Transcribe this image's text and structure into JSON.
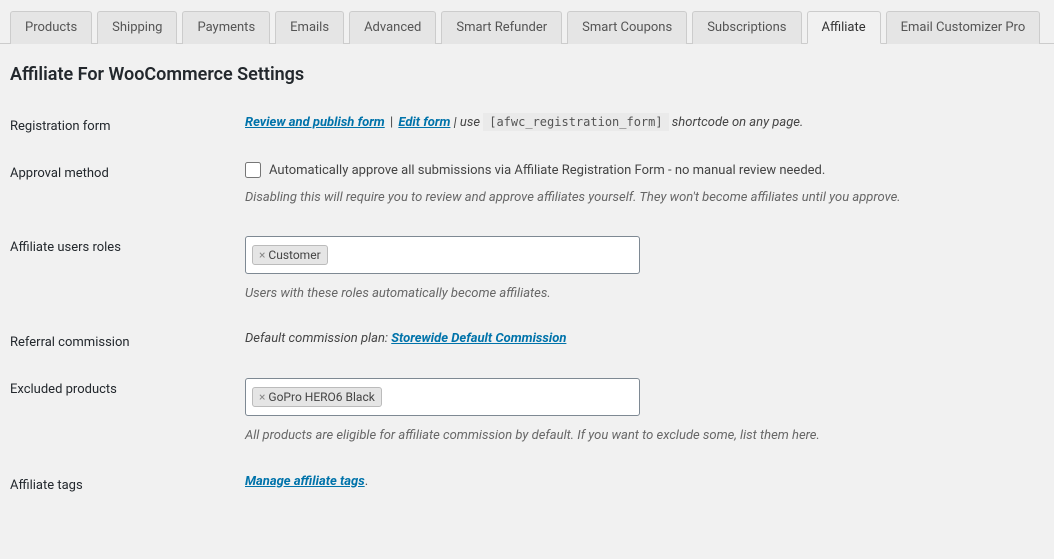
{
  "tabs": [
    {
      "label": "Products",
      "active": false
    },
    {
      "label": "Shipping",
      "active": false
    },
    {
      "label": "Payments",
      "active": false
    },
    {
      "label": "Emails",
      "active": false
    },
    {
      "label": "Advanced",
      "active": false
    },
    {
      "label": "Smart Refunder",
      "active": false
    },
    {
      "label": "Smart Coupons",
      "active": false
    },
    {
      "label": "Subscriptions",
      "active": false
    },
    {
      "label": "Affiliate",
      "active": true
    },
    {
      "label": "Email Customizer Pro",
      "active": false
    }
  ],
  "heading": "Affiliate For WooCommerce Settings",
  "registration": {
    "label": "Registration form",
    "review_link": "Review and publish form",
    "sep1": " | ",
    "edit_link": "Edit form",
    "sep2": " | use ",
    "shortcode": "[afwc_registration_form]",
    "tail": " shortcode on any page."
  },
  "approval": {
    "label": "Approval method",
    "checkbox_label": "Automatically approve all submissions via Affiliate Registration Form - no manual review needed.",
    "helper": "Disabling this will require you to review and approve affiliates yourself. They won't become affiliates until you approve."
  },
  "roles": {
    "label": "Affiliate users roles",
    "tags": [
      "Customer"
    ],
    "helper": "Users with these roles automatically become affiliates."
  },
  "commission": {
    "label": "Referral commission",
    "prefix": "Default commission plan: ",
    "link": "Storewide Default Commission"
  },
  "excluded": {
    "label": "Excluded products",
    "tags": [
      "GoPro HERO6 Black"
    ],
    "helper": "All products are eligible for affiliate commission by default. If you want to exclude some, list them here."
  },
  "affiliate_tags": {
    "label": "Affiliate tags",
    "link": "Manage affiliate tags",
    "period": "."
  }
}
